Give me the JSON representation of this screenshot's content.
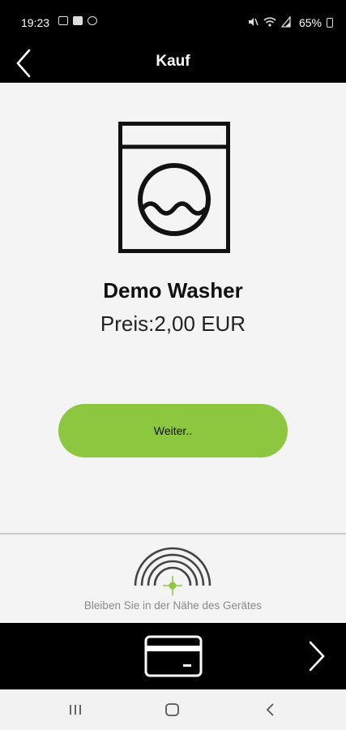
{
  "status_bar": {
    "time": "19:23",
    "battery": "65%",
    "left_icons": [
      "image-icon",
      "sim-icon",
      "sync-icon"
    ],
    "right_icons": [
      "mute-icon",
      "wifi-icon",
      "signal-icon"
    ]
  },
  "app_bar": {
    "title": "Kauf",
    "back_icon": "chevron-left-icon"
  },
  "product": {
    "icon": "washing-machine-icon",
    "name": "Demo Washer",
    "price": "Preis:2,00 EUR"
  },
  "continue_button": {
    "label": "Weiter.."
  },
  "proximity": {
    "icon": "proximity-signal-icon",
    "hint": "Bleiben Sie in der Nähe des Gerätes"
  },
  "bottom_bar": {
    "payment_icon": "credit-card-icon",
    "next_icon": "chevron-right-icon"
  },
  "system_nav": {
    "icons": [
      "recent-apps-icon",
      "home-icon",
      "back-icon"
    ]
  },
  "colors": {
    "accent": "#8dc63f",
    "bars": "#000000",
    "background": "#f4f4f4"
  }
}
